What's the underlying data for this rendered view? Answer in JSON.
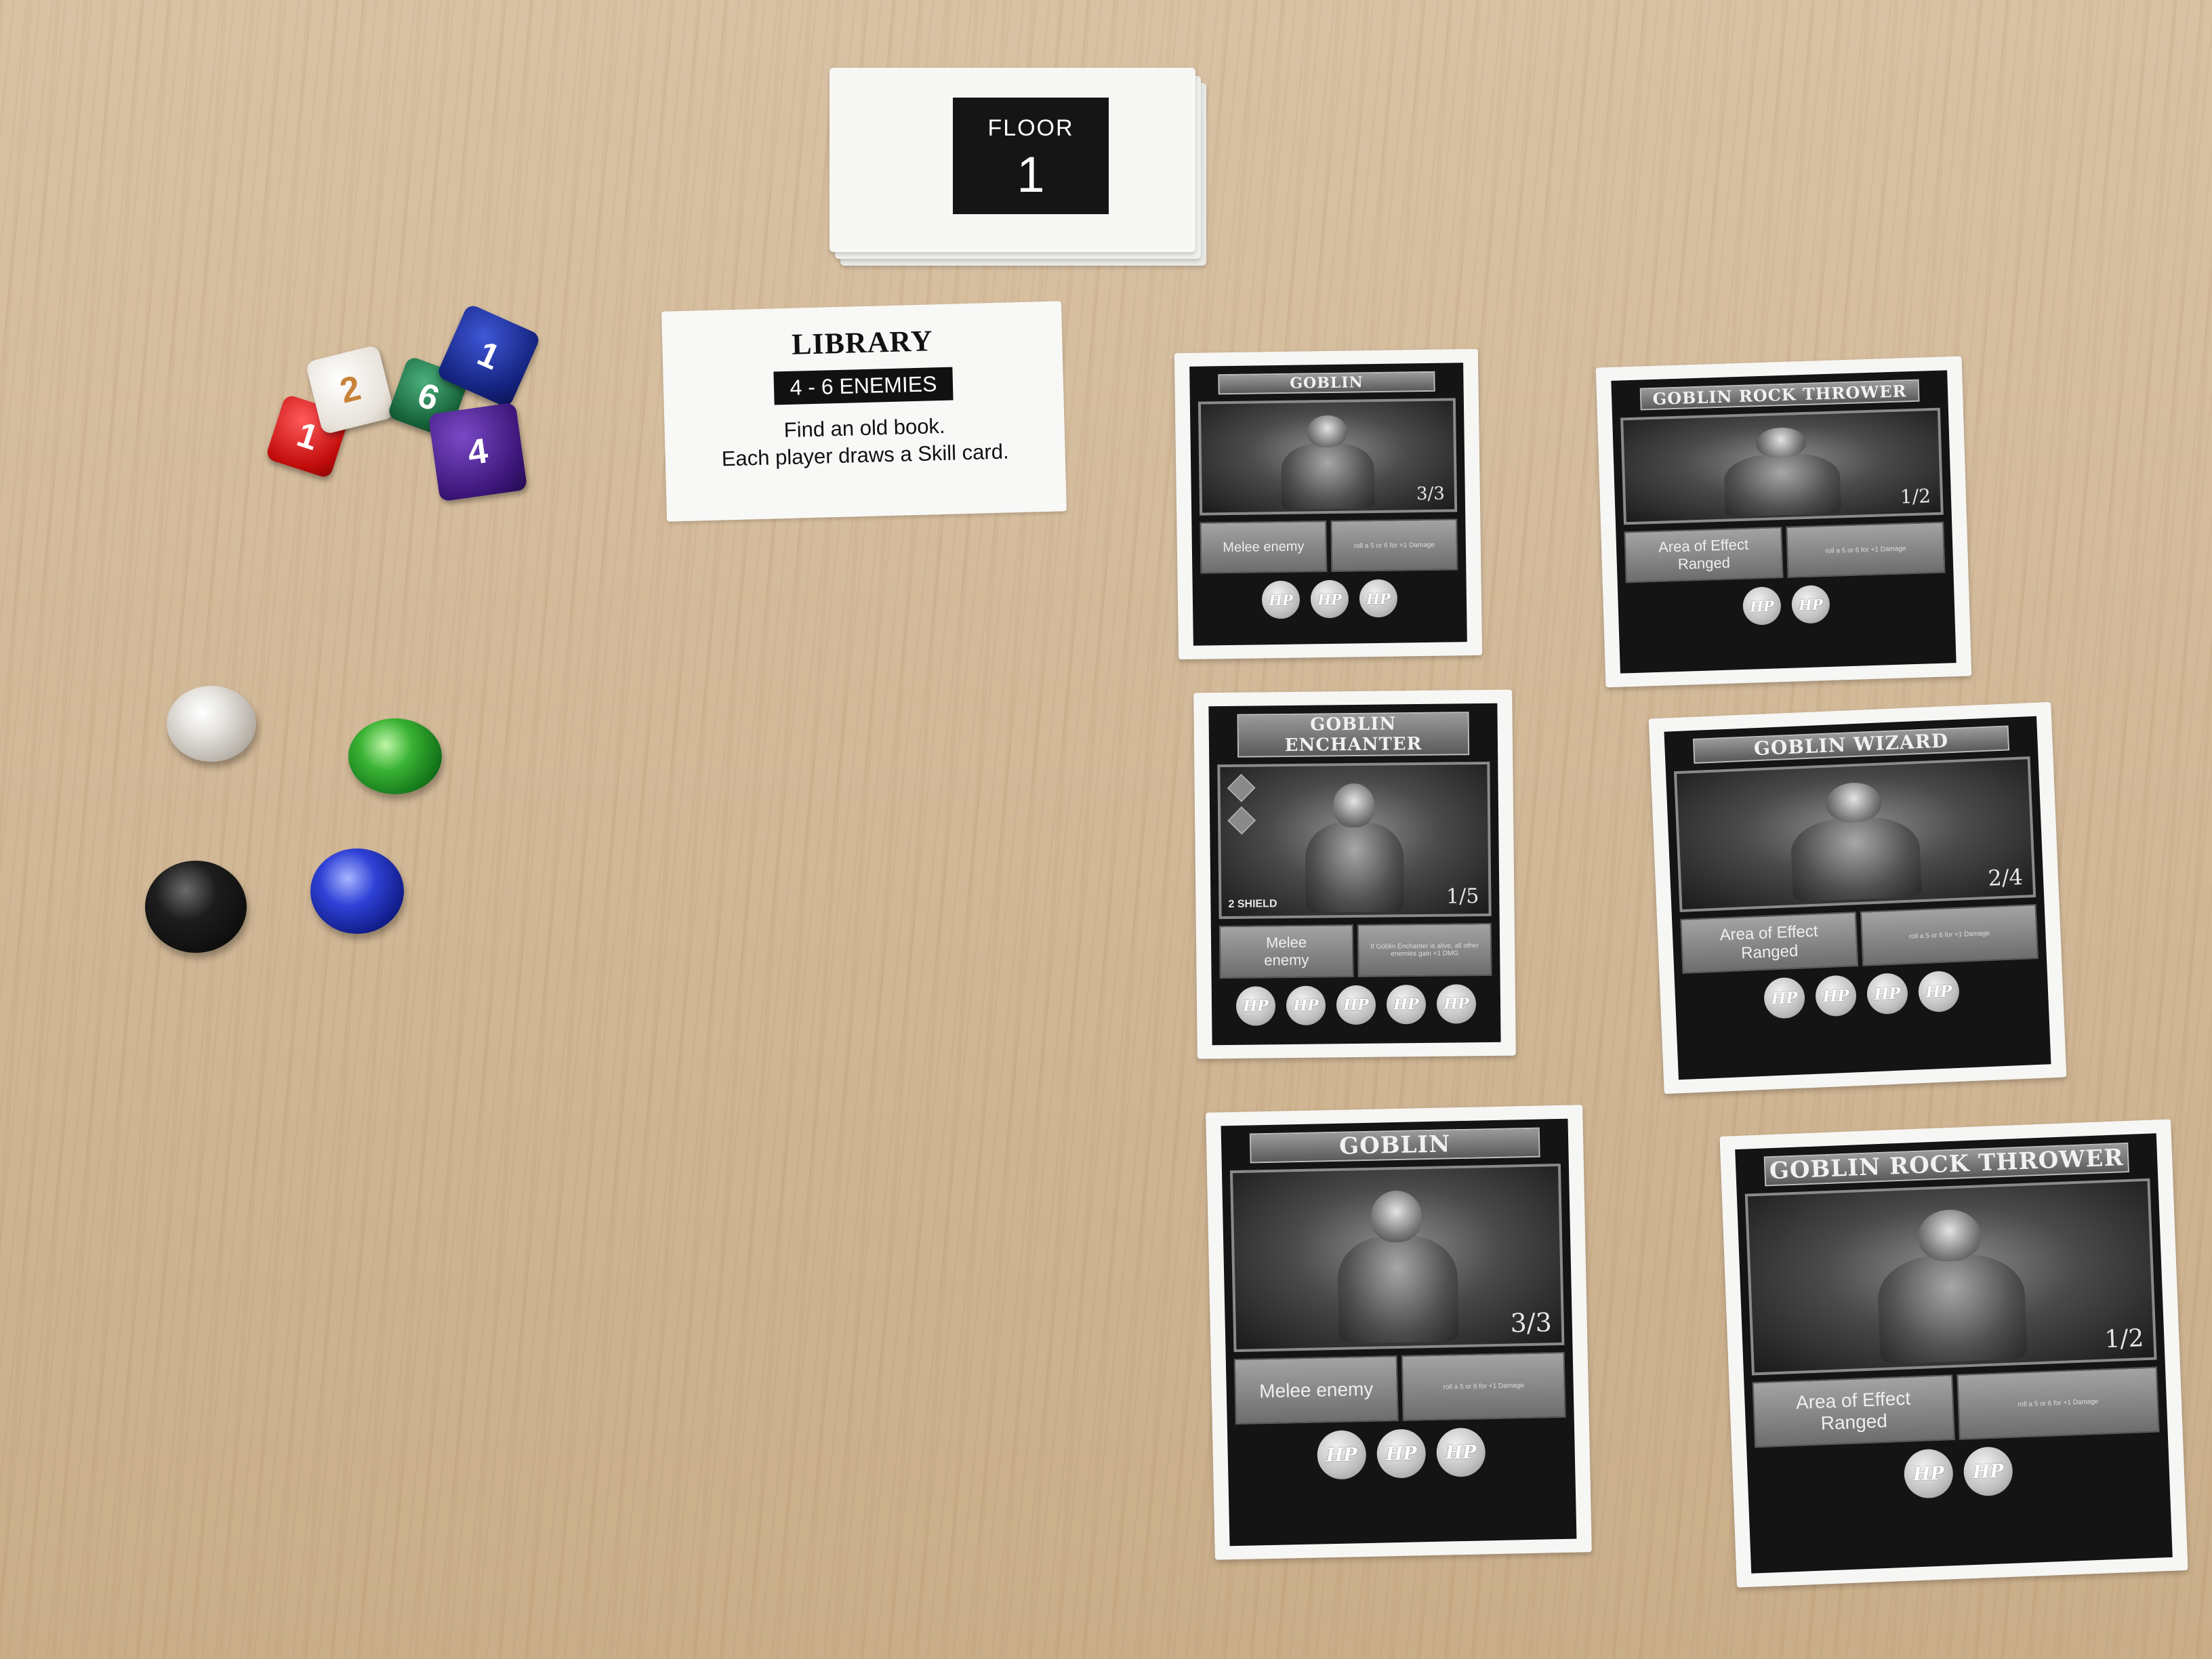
{
  "floor_card": {
    "label": "FLOOR",
    "number": "1"
  },
  "room_card": {
    "title": "LIBRARY",
    "badge": "4 - 6 ENEMIES",
    "lines": [
      "Find an old book.",
      "Each player draws a Skill card."
    ]
  },
  "dice": [
    {
      "color": "#c40d0d",
      "value": "1",
      "side": "4"
    },
    {
      "color": "#e7e2da",
      "value": "2",
      "side": "4"
    },
    {
      "color": "#155f37",
      "value": "6"
    },
    {
      "color": "#14237e",
      "value": "1",
      "side": "5"
    },
    {
      "color": "#3c1679",
      "value": "4",
      "side": "2"
    }
  ],
  "gems": [
    {
      "name": "clear-gem",
      "color": "#dcdad6"
    },
    {
      "name": "green-gem",
      "color": "#2aa52a"
    },
    {
      "name": "black-gem",
      "color": "#111111"
    },
    {
      "name": "blue-gem",
      "color": "#2536c4"
    }
  ],
  "enemy_cards": [
    {
      "name": "GOBLIN",
      "ratio": "3/3",
      "info_left": "Melee enemy",
      "info_right": "roll a 5 or 6 for +1 Damage",
      "hp_count": 3,
      "hp_label": "HP"
    },
    {
      "name": "GOBLIN ROCK THROWER",
      "ratio": "1/2",
      "info_left": "Area of Effect",
      "info_left_2": "Ranged",
      "info_right": "roll a 5 or 6 for +1 Damage",
      "hp_count": 2,
      "hp_label": "HP"
    },
    {
      "name": "GOBLIN ENCHANTER",
      "ratio": "1/5",
      "shield": "2 SHIELD",
      "info_left": "Melee",
      "info_left_2": "enemy",
      "info_right": "If Goblin Enchanter is alive, all other enemies gain +1 DMG",
      "hp_count": 5,
      "hp_label": "HP"
    },
    {
      "name": "GOBLIN WIZARD",
      "ratio": "2/4",
      "info_left": "Area of Effect",
      "info_left_2": "Ranged",
      "info_right": "roll a 5 or 6 for +1 Damage",
      "hp_count": 4,
      "hp_label": "HP"
    },
    {
      "name": "GOBLIN",
      "ratio": "3/3",
      "info_left": "Melee enemy",
      "info_right": "roll a 5 or 6 for +1 Damage",
      "hp_count": 3,
      "hp_label": "HP"
    },
    {
      "name": "GOBLIN ROCK THROWER",
      "ratio": "1/2",
      "info_left": "Area of Effect",
      "info_left_2": "Ranged",
      "info_right": "roll a 5 or 6 for +1 Damage",
      "hp_count": 2,
      "hp_label": "HP"
    }
  ]
}
